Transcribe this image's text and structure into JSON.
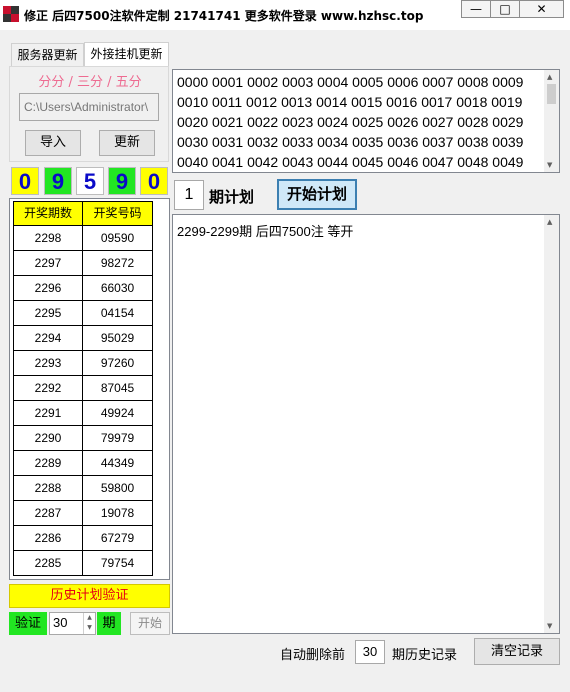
{
  "window": {
    "title": "修正 后四7500注软件定制 21741741 更多软件登录 www.hzhsc.top",
    "minimize_label": "—",
    "maximize_label": "□",
    "close_label": "✕"
  },
  "tabs": [
    {
      "label": "服务器更新"
    },
    {
      "label": "外接挂机更新",
      "active": true
    }
  ],
  "update_panel": {
    "intervals": "分分 / 三分 / 五分",
    "path": "C:\\Users\\Administrator\\",
    "import_label": "导入",
    "update_label": "更新"
  },
  "latest_digits": [
    {
      "value": "0",
      "bg": "#ffff00"
    },
    {
      "value": "9",
      "bg": "#22e622"
    },
    {
      "value": "5",
      "bg": "#ffffff"
    },
    {
      "value": "9",
      "bg": "#22e622"
    },
    {
      "value": "0",
      "bg": "#ffff00"
    }
  ],
  "draw_table": {
    "headers": [
      "开奖期数",
      "开奖号码"
    ],
    "rows": [
      [
        "2298",
        "09590"
      ],
      [
        "2297",
        "98272"
      ],
      [
        "2296",
        "66030"
      ],
      [
        "2295",
        "04154"
      ],
      [
        "2294",
        "95029"
      ],
      [
        "2293",
        "97260"
      ],
      [
        "2292",
        "87045"
      ],
      [
        "2291",
        "49924"
      ],
      [
        "2290",
        "79979"
      ],
      [
        "2289",
        "44349"
      ],
      [
        "2288",
        "59800"
      ],
      [
        "2287",
        "19078"
      ],
      [
        "2286",
        "67279"
      ],
      [
        "2285",
        "79754"
      ]
    ]
  },
  "history": {
    "button_label": "历史计划验证",
    "verify_label": "验证",
    "verify_value": "30",
    "period_label": "期",
    "start_label": "开始"
  },
  "numbers_text": "0000 0001 0002 0003 0004 0005 0006 0007 0008 0009 0010 0011 0012 0013 0014 0015 0016 0017 0018 0019 0020 0021 0022 0023 0024 0025 0026 0027 0028 0029 0030 0031 0032 0033 0034 0035 0036 0037 0038 0039 0040 0041 0042 0043 0044 0045 0046 0047 0048 0049",
  "plan": {
    "count": "1",
    "label": "期计划",
    "start_label": "开始计划"
  },
  "log": {
    "line": "2299-2299期 后四7500注 等开"
  },
  "footer": {
    "auto_delete_label": "自动删除前",
    "auto_delete_value": "30",
    "history_suffix": "期历史记录",
    "clear_label": "清空记录"
  },
  "colors": {
    "yellow": "#ffff00",
    "green": "#22e622",
    "digit_blue": "#0a0ac8",
    "pink": "#ee6b91",
    "red": "#e60012"
  },
  "icons": [
    "app-logo-icon",
    "scroll-up-arrow-icon",
    "scroll-down-arrow-icon",
    "spin-up-icon",
    "spin-down-icon"
  ]
}
